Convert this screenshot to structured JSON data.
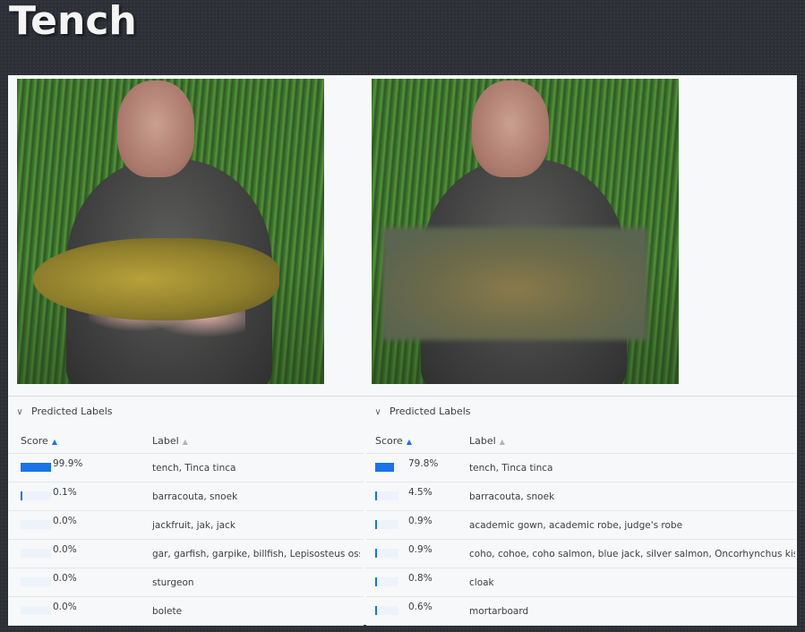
{
  "page": {
    "title": "Tench"
  },
  "left": {
    "section_title": "Predicted Labels",
    "columns": {
      "score": "Score",
      "label": "Label"
    },
    "rows": [
      {
        "score": "99.9%",
        "fill": 0.999,
        "label": "tench, Tinca tinca"
      },
      {
        "score": "0.1%",
        "fill": 0.001,
        "label": "barracouta, snoek"
      },
      {
        "score": "0.0%",
        "fill": 0.0,
        "label": "jackfruit, jak, jack"
      },
      {
        "score": "0.0%",
        "fill": 0.0,
        "label": "gar, garfish, garpike, billfish, Lepisosteus osseus"
      },
      {
        "score": "0.0%",
        "fill": 0.0,
        "label": "sturgeon"
      },
      {
        "score": "0.0%",
        "fill": 0.0,
        "label": "bolete"
      }
    ]
  },
  "right": {
    "section_title": "Predicted Labels",
    "columns": {
      "score": "Score",
      "label": "Label"
    },
    "rows": [
      {
        "score": "79.8%",
        "fill": 0.798,
        "label": "tench, Tinca tinca"
      },
      {
        "score": "4.5%",
        "fill": 0.045,
        "label": "barracouta, snoek"
      },
      {
        "score": "0.9%",
        "fill": 0.009,
        "label": "academic gown, academic robe, judge's robe"
      },
      {
        "score": "0.9%",
        "fill": 0.009,
        "label": "coho, cohoe, coho salmon, blue jack, silver salmon, Oncorhynchus kisutch"
      },
      {
        "score": "0.8%",
        "fill": 0.008,
        "label": "cloak"
      },
      {
        "score": "0.6%",
        "fill": 0.006,
        "label": "mortarboard"
      }
    ]
  },
  "icons": {
    "collapse": "chevron-down-icon",
    "sort_active": "sort-desc-icon",
    "sort_inactive": "sort-icon"
  },
  "colors": {
    "accent": "#1a73e8",
    "background": "#2c2f36",
    "panel": "#f7f8fa"
  }
}
